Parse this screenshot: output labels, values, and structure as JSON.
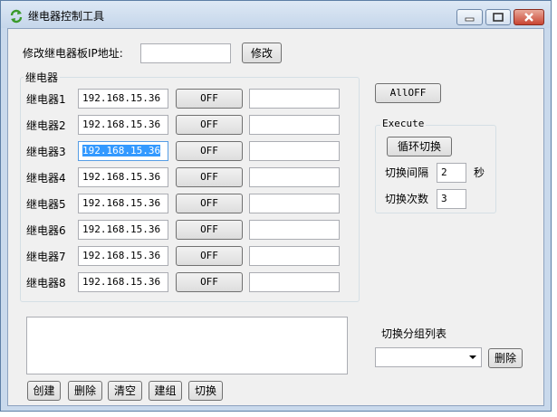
{
  "window": {
    "title": "继电器控制工具"
  },
  "ip_modify": {
    "label": "修改继电器板IP地址:",
    "value": "",
    "button": "修改"
  },
  "relay_group": {
    "label": "继电器",
    "relays": [
      {
        "label": "继电器1",
        "ip": "192.168.15.36",
        "button": "OFF",
        "status": ""
      },
      {
        "label": "继电器2",
        "ip": "192.168.15.36",
        "button": "OFF",
        "status": ""
      },
      {
        "label": "继电器3",
        "ip": "192.168.15.36",
        "button": "OFF",
        "status": ""
      },
      {
        "label": "继电器4",
        "ip": "192.168.15.36",
        "button": "OFF",
        "status": ""
      },
      {
        "label": "继电器5",
        "ip": "192.168.15.36",
        "button": "OFF",
        "status": ""
      },
      {
        "label": "继电器6",
        "ip": "192.168.15.36",
        "button": "OFF",
        "status": ""
      },
      {
        "label": "继电器7",
        "ip": "192.168.15.36",
        "button": "OFF",
        "status": ""
      },
      {
        "label": "继电器8",
        "ip": "192.168.15.36",
        "button": "OFF",
        "status": ""
      }
    ]
  },
  "all_off_button": "AllOFF",
  "execute": {
    "label": "Execute",
    "cycle_button": "循环切换",
    "interval_label": "切换间隔",
    "interval_value": "2",
    "interval_unit": "秒",
    "count_label": "切换次数",
    "count_value": "3"
  },
  "group_list": {
    "label": "切换分组列表",
    "selected": "",
    "delete_button": "删除"
  },
  "bottom_buttons": {
    "create": "创建",
    "delete": "删除",
    "clear": "清空",
    "build_group": "建组",
    "switch": "切换"
  }
}
